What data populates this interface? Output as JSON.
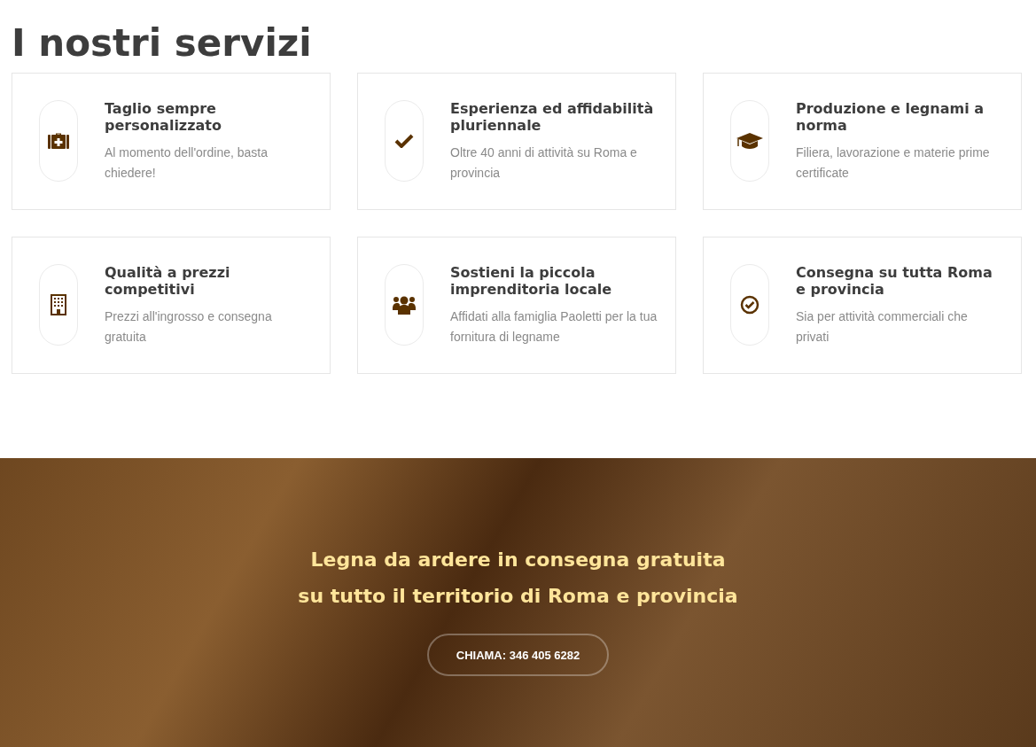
{
  "heading": "I nostri servizi",
  "services": [
    {
      "title": "Taglio sempre personalizzato",
      "text": "Al momento dell'ordine, basta chiedere!"
    },
    {
      "title": "Esperienza ed affidabilità pluriennale",
      "text": "Oltre 40 anni di attività su Roma e provincia"
    },
    {
      "title": "Produzione e legnami a norma",
      "text": "Filiera, lavorazione e materie prime certificate"
    },
    {
      "title": "Qualità a prezzi competitivi",
      "text": "Prezzi all'ingrosso e consegna gratuita"
    },
    {
      "title": "Sostieni la piccola imprenditoria locale",
      "text": "Affidati alla famiglia Paoletti per la tua fornitura di legname"
    },
    {
      "title": "Consegna su tutta Roma e provincia",
      "text": "Sia per attività commerciali che privati"
    }
  ],
  "banner": {
    "lines": [
      "Legna da ardere in consegna gratuita",
      "su tutto il territorio di Roma e provincia"
    ],
    "button": "CHIAMA: 346 405 6282"
  }
}
